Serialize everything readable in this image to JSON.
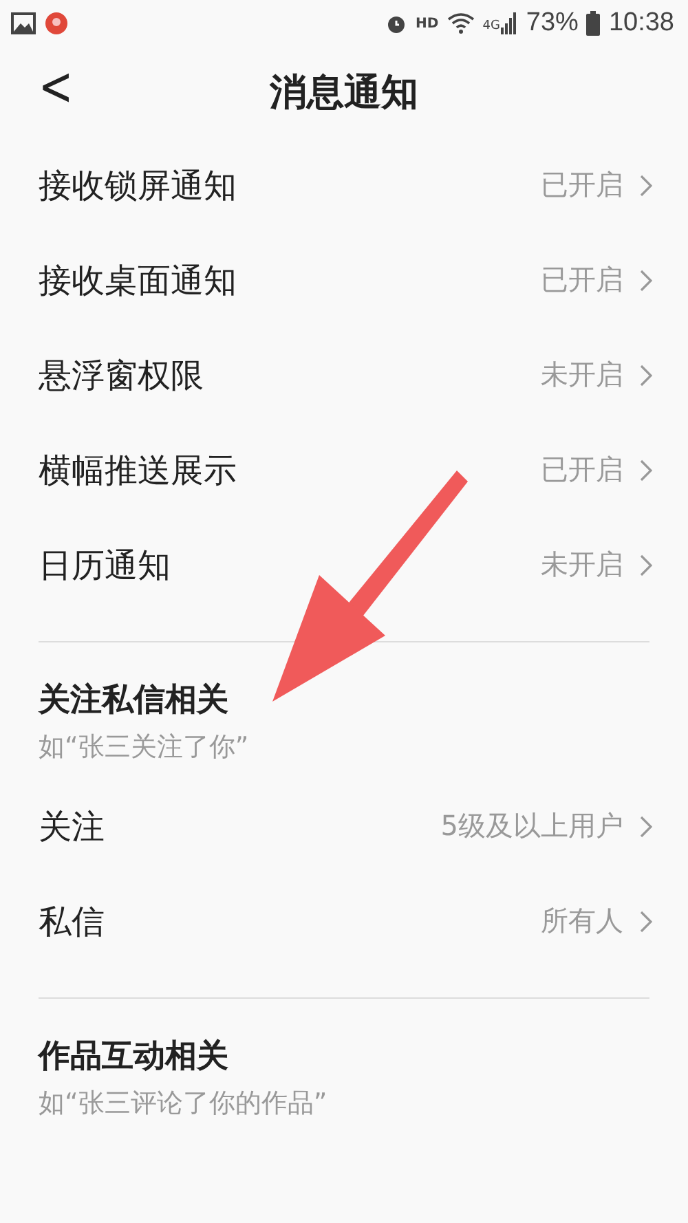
{
  "status_bar": {
    "hd": "HD",
    "network": "4G",
    "battery": "73%",
    "time": "10:38"
  },
  "header": {
    "back": "<",
    "title": "消息通知"
  },
  "sections": [
    {
      "items": [
        {
          "label": "接收锁屏通知",
          "value": "已开启"
        },
        {
          "label": "接收桌面通知",
          "value": "已开启"
        },
        {
          "label": "悬浮窗权限",
          "value": "未开启"
        },
        {
          "label": "横幅推送展示",
          "value": "已开启"
        },
        {
          "label": "日历通知",
          "value": "未开启"
        }
      ]
    },
    {
      "title": "关注私信相关",
      "subtitle": "如“张三关注了你”",
      "items": [
        {
          "label": "关注",
          "value": "5级及以上用户"
        },
        {
          "label": "私信",
          "value": "所有人"
        }
      ]
    },
    {
      "title": "作品互动相关",
      "subtitle": "如“张三评论了你的作品”"
    }
  ]
}
